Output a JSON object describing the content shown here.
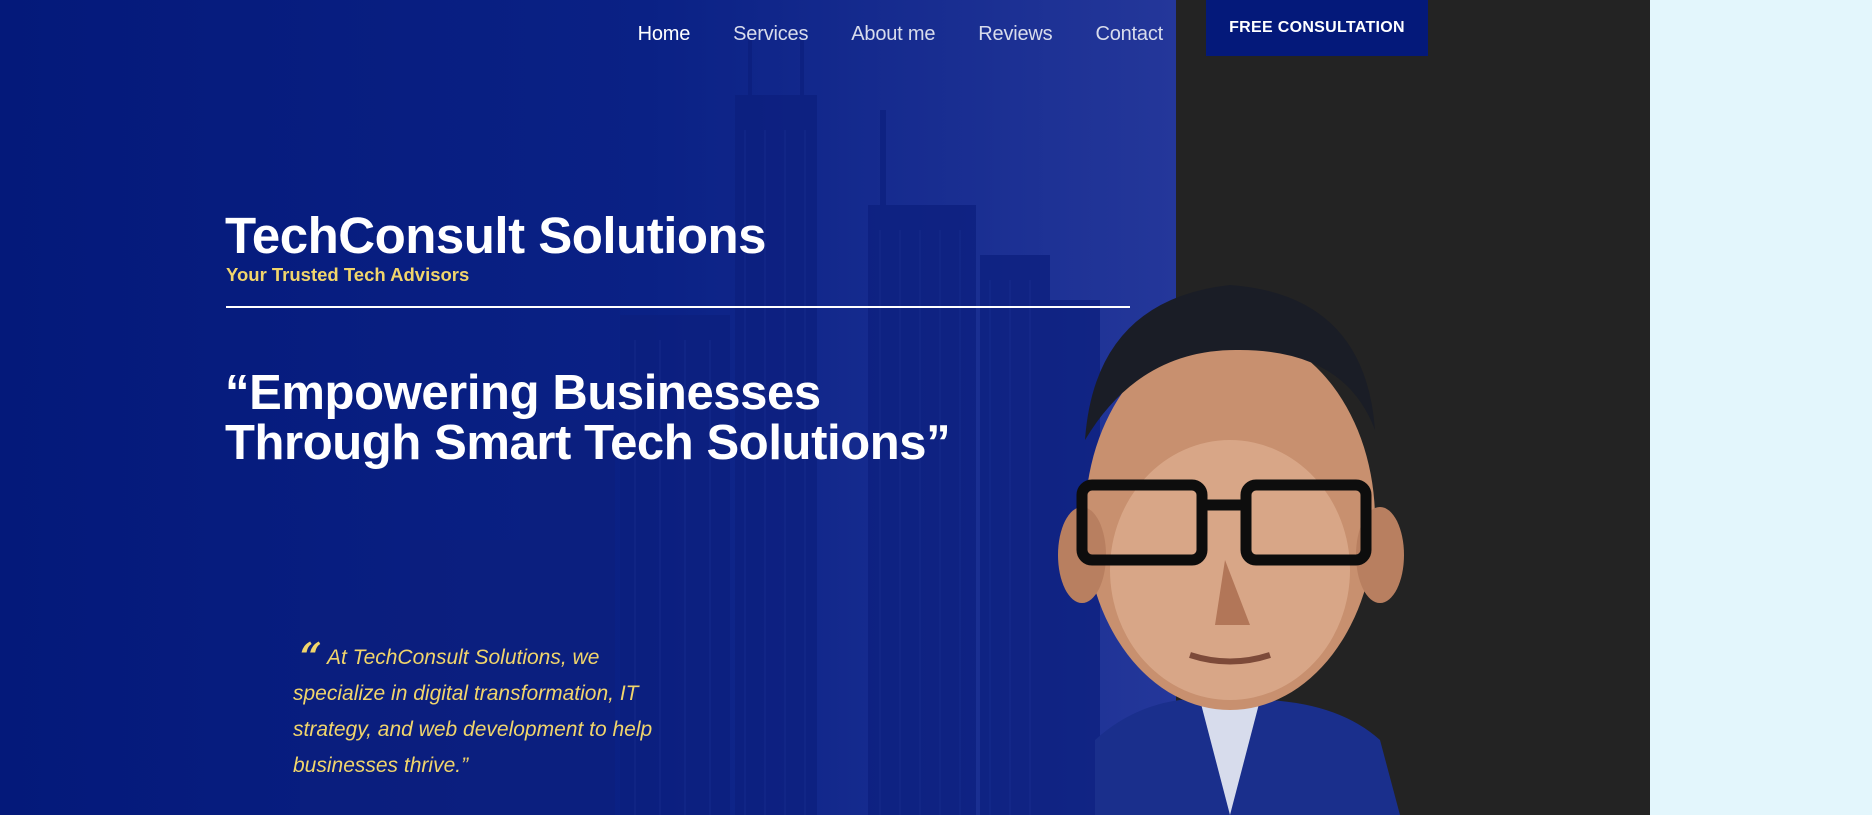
{
  "nav": {
    "items": [
      {
        "label": "Home",
        "active": true
      },
      {
        "label": "Services",
        "active": false
      },
      {
        "label": "About me",
        "active": false
      },
      {
        "label": "Reviews",
        "active": false
      },
      {
        "label": "Contact",
        "active": false
      }
    ],
    "cta_label": "FREE CONSULTATION"
  },
  "brand": {
    "title": "TechConsult Solutions",
    "tagline": "Your Trusted Tech Advisors"
  },
  "hero": {
    "headline": "“Empowering Businesses Through Smart Tech Solutions”",
    "quote_mark": "“",
    "quote": "At TechConsult Solutions, we specialize in digital transformation, IT strategy, and web development to help businesses thrive.”"
  },
  "colors": {
    "primary_blue": "#04197a",
    "accent_yellow": "#f1d56b",
    "dark_panel": "#232323",
    "page_background": "#e3f6fc"
  }
}
